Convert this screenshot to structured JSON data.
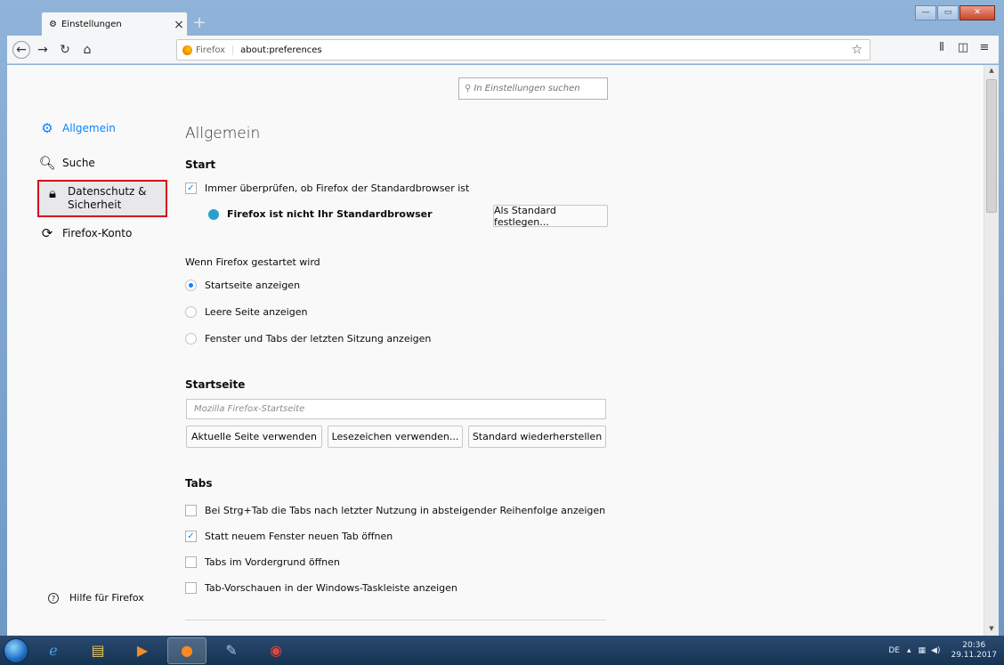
{
  "browser": {
    "tab_title": "Einstellungen",
    "tab_close": "×",
    "new_tab": "+",
    "url_identity": "Firefox",
    "url": "about:preferences"
  },
  "search": {
    "placeholder": "In Einstellungen suchen"
  },
  "sidebar": {
    "items": [
      {
        "label": "Allgemein",
        "icon": "gear-icon",
        "selected": true
      },
      {
        "label": "Suche",
        "icon": "search-icon"
      },
      {
        "label": "Datenschutz &",
        "label2": "Sicherheit",
        "icon": "lock-icon",
        "highlighted": true
      },
      {
        "label": "Firefox-Konto",
        "icon": "sync-icon"
      }
    ],
    "help": "Hilfe für Firefox"
  },
  "main": {
    "title": "Allgemein",
    "start": {
      "heading": "Start",
      "check_default": "Immer überprüfen, ob Firefox der Standardbrowser ist",
      "not_default": "Firefox ist nicht Ihr Standardbrowser",
      "set_default_button": "Als Standard festlegen...",
      "on_start_label": "Wenn Firefox gestartet wird",
      "options": [
        "Startseite anzeigen",
        "Leere Seite anzeigen",
        "Fenster und Tabs der letzten Sitzung anzeigen"
      ],
      "selected_option": 0
    },
    "homepage": {
      "heading": "Startseite",
      "placeholder": "Mozilla Firefox-Startseite",
      "buttons": [
        "Aktuelle Seite verwenden",
        "Lesezeichen verwenden...",
        "Standard wiederherstellen"
      ]
    },
    "tabs": {
      "heading": "Tabs",
      "options": [
        {
          "label": "Bei Strg+Tab die Tabs nach letzter Nutzung in absteigender Reihenfolge anzeigen",
          "checked": false
        },
        {
          "label": "Statt neuem Fenster neuen Tab öffnen",
          "checked": true
        },
        {
          "label": "Tabs im Vordergrund öffnen",
          "checked": false
        },
        {
          "label": "Tab-Vorschauen in der Windows-Taskleiste anzeigen",
          "checked": false
        }
      ]
    }
  },
  "taskbar": {
    "language": "DE",
    "time": "20:36",
    "date": "29.11.2017"
  },
  "colors": {
    "accent": "#0a84ff",
    "highlight_border": "#d70022"
  }
}
